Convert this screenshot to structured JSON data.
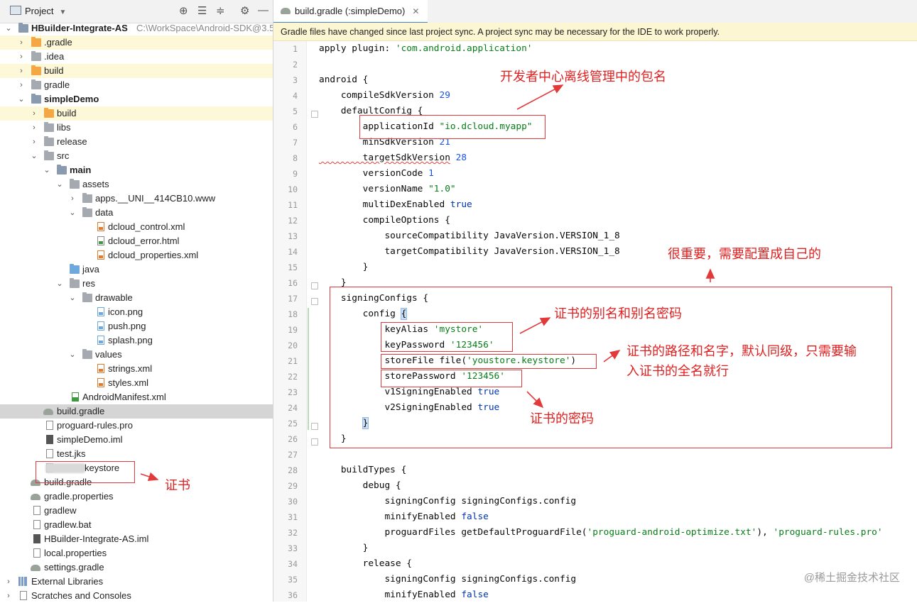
{
  "project_panel": {
    "title": "Project",
    "tree": [
      {
        "label": "HBuilder-Integrate-AS",
        "path": "C:\\WorkSpace\\Android-SDK@3.5..",
        "bold": true
      },
      {
        "label": ".gradle"
      },
      {
        "label": ".idea"
      },
      {
        "label": "build"
      },
      {
        "label": "gradle"
      },
      {
        "label": "simpleDemo",
        "bold": true
      },
      {
        "label": "build"
      },
      {
        "label": "libs"
      },
      {
        "label": "release"
      },
      {
        "label": "src"
      },
      {
        "label": "main",
        "bold": true
      },
      {
        "label": "assets"
      },
      {
        "label": "apps.__UNI__414CB10.www"
      },
      {
        "label": "data"
      },
      {
        "label": "dcloud_control.xml"
      },
      {
        "label": "dcloud_error.html"
      },
      {
        "label": "dcloud_properties.xml"
      },
      {
        "label": "java"
      },
      {
        "label": "res"
      },
      {
        "label": "drawable"
      },
      {
        "label": "icon.png"
      },
      {
        "label": "push.png"
      },
      {
        "label": "splash.png"
      },
      {
        "label": "values"
      },
      {
        "label": "strings.xml"
      },
      {
        "label": "styles.xml"
      },
      {
        "label": "AndroidManifest.xml"
      },
      {
        "label": "build.gradle"
      },
      {
        "label": "proguard-rules.pro"
      },
      {
        "label": "simpleDemo.iml"
      },
      {
        "label": "test.jks"
      },
      {
        "label": "keystore"
      },
      {
        "label": "build.gradle"
      },
      {
        "label": "gradle.properties"
      },
      {
        "label": "gradlew"
      },
      {
        "label": "gradlew.bat"
      },
      {
        "label": "HBuilder-Integrate-AS.iml"
      },
      {
        "label": "local.properties"
      },
      {
        "label": "settings.gradle"
      },
      {
        "label": "External Libraries"
      },
      {
        "label": "Scratches and Consoles"
      }
    ]
  },
  "editor": {
    "tab_label": "build.gradle (:simpleDemo)",
    "banner": "Gradle files have changed since last project sync. A project sync may be necessary for the IDE to work properly.",
    "line_numbers": [
      "1",
      "2",
      "3",
      "4",
      "5",
      "6",
      "7",
      "8",
      "9",
      "10",
      "11",
      "12",
      "13",
      "14",
      "15",
      "16",
      "17",
      "18",
      "19",
      "20",
      "21",
      "22",
      "23",
      "24",
      "25",
      "26",
      "27",
      "28",
      "29",
      "30",
      "31",
      "32",
      "33",
      "34",
      "35",
      "36"
    ],
    "code": {
      "l1_a": "apply plugin: ",
      "l1_b": "'com.android.application'",
      "l3": "android {",
      "l4_a": "    compileSdkVersion ",
      "l4_b": "29",
      "l5": "    defaultConfig {",
      "l6_a": "        applicationId ",
      "l6_b": "\"io.dcloud.myapp\"",
      "l7_a": "        minSdkVersion ",
      "l7_b": "21",
      "l8_a": "        targetSdkVersion",
      "l8_b": " 28",
      "l9_a": "        versionCode ",
      "l9_b": "1",
      "l10_a": "        versionName ",
      "l10_b": "\"1.0\"",
      "l11_a": "        multiDexEnabled ",
      "l11_b": "true",
      "l12": "        compileOptions {",
      "l13": "            sourceCompatibility JavaVersion.VERSION_1_8",
      "l14": "            targetCompatibility JavaVersion.VERSION_1_8",
      "l15": "        }",
      "l16": "    }",
      "l17": "    signingConfigs {",
      "l18_a": "        config ",
      "l18_b": "{",
      "l19_a": "            keyAlias ",
      "l19_b": "'mystore'",
      "l20_a": "            keyPassword ",
      "l20_b": "'123456'",
      "l21_a": "            storeFile file(",
      "l21_b": "'youstore.keystore'",
      "l21_c": ")",
      "l22_a": "            storePassword ",
      "l22_b": "'123456'",
      "l23_a": "            v1SigningEnabled ",
      "l23_b": "true",
      "l24_a": "            v2SigningEnabled ",
      "l24_b": "true",
      "l25_a": "        ",
      "l25_b": "}",
      "l26": "    }",
      "l28": "    buildTypes {",
      "l29": "        debug {",
      "l30": "            signingConfig signingConfigs.config",
      "l31_a": "            minifyEnabled ",
      "l31_b": "false",
      "l32_a": "            proguardFiles getDefaultProguardFile(",
      "l32_b": "'proguard-android-optimize.txt'",
      "l32_c": "), ",
      "l32_d": "'proguard-rules.pro'",
      "l33": "        }",
      "l34": "        release {",
      "l35": "            signingConfig signingConfigs.config",
      "l36_a": "            minifyEnabled ",
      "l36_b": "false"
    }
  },
  "annotations": {
    "package_name": "开发者中心离线管理中的包名",
    "important": "很重要，需要配置成自己的",
    "alias": "证书的别名和别名密码",
    "store_path": "证书的路径和名字，默认同级，只需要输入证书的全名就行",
    "store_password": "证书的密码",
    "certificate": "证书"
  },
  "watermark": "@稀土掘金技术社区",
  "icons": [
    "project-icon",
    "caret-down-icon",
    "target-icon",
    "collapse-all-icon",
    "expand-all-icon",
    "gear-icon",
    "minimize-icon",
    "gradle-icon",
    "close-icon",
    "folder-icon",
    "file-icon"
  ],
  "colors": {
    "string": "#067d17",
    "number": "#1750eb",
    "keyword": "#0033b3",
    "annotation": "#e02020",
    "banner": "#fdf6d3",
    "tab_underline": "#4083c9"
  }
}
